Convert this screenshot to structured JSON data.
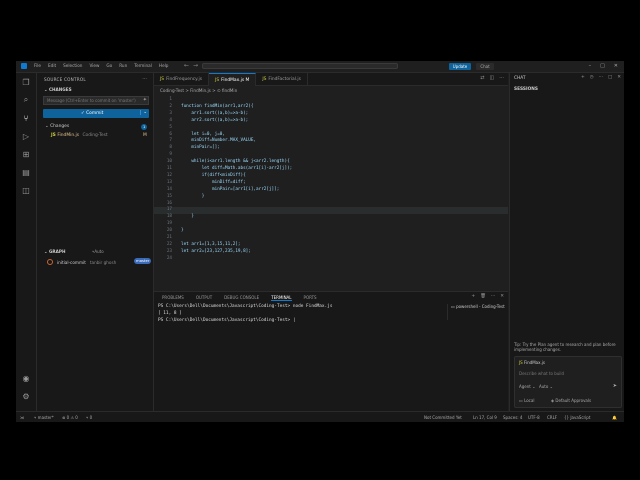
{
  "menu": [
    "File",
    "Edit",
    "Selection",
    "View",
    "Go",
    "Run",
    "Terminal",
    "Help"
  ],
  "titlebar": {
    "update_label": "Update",
    "chat_label": "Chat"
  },
  "sidebar": {
    "header": "SOURCE CONTROL",
    "section": "CHANGES",
    "message_placeholder": "Message (Ctrl+Enter to commit on 'master')",
    "commit_label": "✓ Commit",
    "changes_label": "Changes",
    "changes_count": "1",
    "file_name": "FindMin.js",
    "file_folder": "Coding-Test",
    "file_status": "M",
    "graph_header": "GRAPH",
    "graph_auto": "Auto",
    "commit_message": "initial-commit",
    "commit_author": "tanbir ghosh",
    "branch_badge": "master"
  },
  "editor": {
    "tabs": [
      {
        "label": "FindFrequency.js",
        "active": false
      },
      {
        "label": "FindMax.js M",
        "active": true
      },
      {
        "label": "FindFactorial.js",
        "active": false
      }
    ],
    "breadcrumb": "Coding-Test > FindMin.js > ⊙ findMin",
    "lines": [
      {
        "n": "1",
        "t": ""
      },
      {
        "n": "2",
        "t": "function findMin(arr1,arr2){"
      },
      {
        "n": "3",
        "t": "    arr1.sort((a,b)=>a-b);"
      },
      {
        "n": "4",
        "t": "    arr2.sort((a,b)=>a-b);"
      },
      {
        "n": "5",
        "t": ""
      },
      {
        "n": "6",
        "t": "    let i=0, j=0,"
      },
      {
        "n": "7",
        "t": "    minDiff=Number.MAX_VALUE,"
      },
      {
        "n": "8",
        "t": "    minPair=[];"
      },
      {
        "n": "9",
        "t": ""
      },
      {
        "n": "10",
        "t": "    while(i<arr1.length && j<arr2.length){"
      },
      {
        "n": "11",
        "t": "        let diff=Math.abs(arr1[i]-arr2[j]);"
      },
      {
        "n": "12",
        "t": "        if(diff<minDiff){"
      },
      {
        "n": "13",
        "t": "            minDiff=diff;"
      },
      {
        "n": "14",
        "t": "            minPair=[arr1[i],arr2[j]];"
      },
      {
        "n": "15",
        "t": "        }"
      },
      {
        "n": "16",
        "t": ""
      },
      {
        "n": "17",
        "t": ""
      },
      {
        "n": "18",
        "t": "    }"
      },
      {
        "n": "19",
        "t": ""
      },
      {
        "n": "20",
        "t": "}"
      },
      {
        "n": "21",
        "t": ""
      },
      {
        "n": "22",
        "t": "let arr1=[1,3,15,11,2];"
      },
      {
        "n": "23",
        "t": "let arr2=[23,127,235,19,8];"
      },
      {
        "n": "24",
        "t": ""
      }
    ]
  },
  "panel": {
    "tabs": [
      {
        "label": "PROBLEMS",
        "active": false
      },
      {
        "label": "OUTPUT",
        "active": false
      },
      {
        "label": "DEBUG CONSOLE",
        "active": false
      },
      {
        "label": "TERMINAL",
        "active": true
      },
      {
        "label": "PORTS",
        "active": false
      }
    ],
    "terminal_side": "powershell - Coding-Test",
    "lines": [
      "PS C:\\Users\\Dell\\Documents\\Javascript\\Coding-Test> node FindMax.js",
      "[ 11, 8 ]",
      "PS C:\\Users\\Dell\\Documents\\Javascript\\Coding-Test> |"
    ]
  },
  "chat": {
    "title": "CHAT",
    "sessions": "SESSIONS",
    "tip": "Tip: Try the Plan agent to research and plan before implementing changes.",
    "context_file": "FindMax.js",
    "placeholder": "Describe what to build",
    "mode": "Agent",
    "model": "Auto",
    "local": "Local",
    "approvals": "Default Approvals"
  },
  "status": {
    "branch": "master*",
    "errors": "⊗ 0  ⚠ 0",
    "ports": "⑂ 0",
    "git": "Not Committed Yet",
    "position": "Ln 17, Col 9",
    "spaces": "Spaces: 4",
    "encoding": "UTF-8",
    "eol": "CRLF",
    "lang": "{} JavaScript"
  }
}
